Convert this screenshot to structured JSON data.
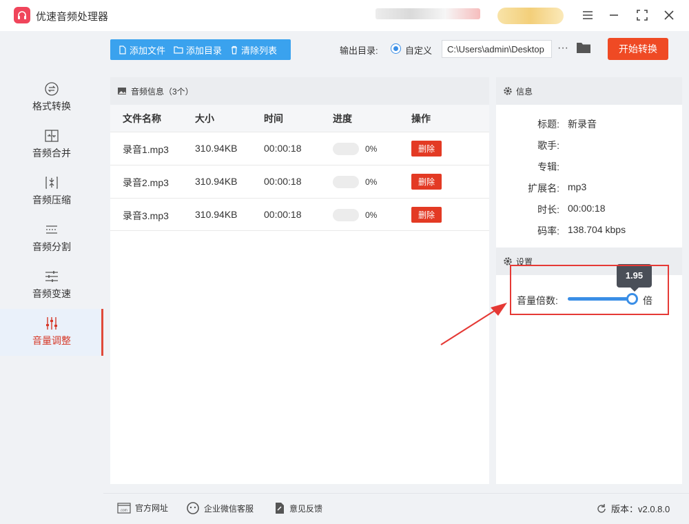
{
  "app": {
    "title": "优速音频处理器"
  },
  "sidebar": {
    "items": [
      {
        "label": "格式转换",
        "icon": "format-convert-icon"
      },
      {
        "label": "音频合并",
        "icon": "merge-icon"
      },
      {
        "label": "音频压缩",
        "icon": "compress-icon"
      },
      {
        "label": "音频分割",
        "icon": "split-icon"
      },
      {
        "label": "音频变速",
        "icon": "speed-icon"
      },
      {
        "label": "音量调整",
        "icon": "volume-adjust-icon",
        "active": true
      }
    ]
  },
  "toolbar": {
    "add_file": "添加文件",
    "add_dir": "添加目录",
    "clear_list": "清除列表",
    "output_dir_label": "输出目录:",
    "custom_label": "自定义",
    "output_path": "C:\\Users\\admin\\Desktop",
    "more": "···",
    "start": "开始转换"
  },
  "audio_panel": {
    "title": "音频信息（3个）",
    "columns": [
      "文件名称",
      "大小",
      "时间",
      "进度",
      "操作"
    ],
    "rows": [
      {
        "name": "录音1.mp3",
        "size": "310.94KB",
        "time": "00:00:18",
        "progress_pct": 0,
        "progress": "0%",
        "action": "删除"
      },
      {
        "name": "录音2.mp3",
        "size": "310.94KB",
        "time": "00:00:18",
        "progress_pct": 0,
        "progress": "0%",
        "action": "删除"
      },
      {
        "name": "录音3.mp3",
        "size": "310.94KB",
        "time": "00:00:18",
        "progress_pct": 0,
        "progress": "0%",
        "action": "删除"
      }
    ]
  },
  "info_panel": {
    "title": "信息",
    "fields": [
      {
        "label": "标题:",
        "value": "新录音"
      },
      {
        "label": "歌手:",
        "value": ""
      },
      {
        "label": "专辑:",
        "value": ""
      },
      {
        "label": "扩展名:",
        "value": "mp3"
      },
      {
        "label": "时长:",
        "value": "00:00:18"
      },
      {
        "label": "码率:",
        "value": "138.704 kbps"
      }
    ]
  },
  "settings_panel": {
    "title": "设置",
    "volume_label": "音量倍数:",
    "volume_value": "1.95",
    "volume_fraction": 0.97,
    "volume_unit": "倍"
  },
  "footer": {
    "website": "官方网址",
    "wechat_service": "企业微信客服",
    "feedback": "意见反馈",
    "version": "版本：v2.0.8.0"
  },
  "colors": {
    "accent_blue": "#3aa2ee",
    "start_red": "#ef4a24",
    "delete_red": "#e33a24",
    "active_red": "#d63a2a",
    "annotation_red": "#e53935"
  }
}
